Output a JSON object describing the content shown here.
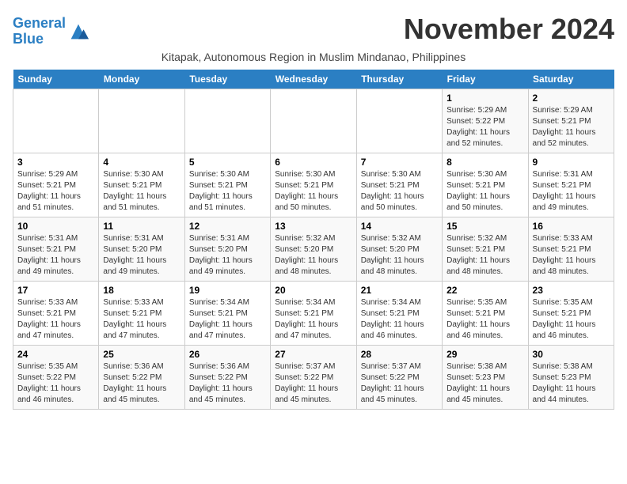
{
  "header": {
    "logo_line1": "General",
    "logo_line2": "Blue",
    "month_title": "November 2024",
    "subtitle": "Kitapak, Autonomous Region in Muslim Mindanao, Philippines"
  },
  "days_of_week": [
    "Sunday",
    "Monday",
    "Tuesday",
    "Wednesday",
    "Thursday",
    "Friday",
    "Saturday"
  ],
  "weeks": [
    {
      "days": [
        {
          "num": "",
          "info": ""
        },
        {
          "num": "",
          "info": ""
        },
        {
          "num": "",
          "info": ""
        },
        {
          "num": "",
          "info": ""
        },
        {
          "num": "",
          "info": ""
        },
        {
          "num": "1",
          "info": "Sunrise: 5:29 AM\nSunset: 5:22 PM\nDaylight: 11 hours\nand 52 minutes."
        },
        {
          "num": "2",
          "info": "Sunrise: 5:29 AM\nSunset: 5:21 PM\nDaylight: 11 hours\nand 52 minutes."
        }
      ]
    },
    {
      "days": [
        {
          "num": "3",
          "info": "Sunrise: 5:29 AM\nSunset: 5:21 PM\nDaylight: 11 hours\nand 51 minutes."
        },
        {
          "num": "4",
          "info": "Sunrise: 5:30 AM\nSunset: 5:21 PM\nDaylight: 11 hours\nand 51 minutes."
        },
        {
          "num": "5",
          "info": "Sunrise: 5:30 AM\nSunset: 5:21 PM\nDaylight: 11 hours\nand 51 minutes."
        },
        {
          "num": "6",
          "info": "Sunrise: 5:30 AM\nSunset: 5:21 PM\nDaylight: 11 hours\nand 50 minutes."
        },
        {
          "num": "7",
          "info": "Sunrise: 5:30 AM\nSunset: 5:21 PM\nDaylight: 11 hours\nand 50 minutes."
        },
        {
          "num": "8",
          "info": "Sunrise: 5:30 AM\nSunset: 5:21 PM\nDaylight: 11 hours\nand 50 minutes."
        },
        {
          "num": "9",
          "info": "Sunrise: 5:31 AM\nSunset: 5:21 PM\nDaylight: 11 hours\nand 49 minutes."
        }
      ]
    },
    {
      "days": [
        {
          "num": "10",
          "info": "Sunrise: 5:31 AM\nSunset: 5:21 PM\nDaylight: 11 hours\nand 49 minutes."
        },
        {
          "num": "11",
          "info": "Sunrise: 5:31 AM\nSunset: 5:20 PM\nDaylight: 11 hours\nand 49 minutes."
        },
        {
          "num": "12",
          "info": "Sunrise: 5:31 AM\nSunset: 5:20 PM\nDaylight: 11 hours\nand 49 minutes."
        },
        {
          "num": "13",
          "info": "Sunrise: 5:32 AM\nSunset: 5:20 PM\nDaylight: 11 hours\nand 48 minutes."
        },
        {
          "num": "14",
          "info": "Sunrise: 5:32 AM\nSunset: 5:20 PM\nDaylight: 11 hours\nand 48 minutes."
        },
        {
          "num": "15",
          "info": "Sunrise: 5:32 AM\nSunset: 5:21 PM\nDaylight: 11 hours\nand 48 minutes."
        },
        {
          "num": "16",
          "info": "Sunrise: 5:33 AM\nSunset: 5:21 PM\nDaylight: 11 hours\nand 48 minutes."
        }
      ]
    },
    {
      "days": [
        {
          "num": "17",
          "info": "Sunrise: 5:33 AM\nSunset: 5:21 PM\nDaylight: 11 hours\nand 47 minutes."
        },
        {
          "num": "18",
          "info": "Sunrise: 5:33 AM\nSunset: 5:21 PM\nDaylight: 11 hours\nand 47 minutes."
        },
        {
          "num": "19",
          "info": "Sunrise: 5:34 AM\nSunset: 5:21 PM\nDaylight: 11 hours\nand 47 minutes."
        },
        {
          "num": "20",
          "info": "Sunrise: 5:34 AM\nSunset: 5:21 PM\nDaylight: 11 hours\nand 47 minutes."
        },
        {
          "num": "21",
          "info": "Sunrise: 5:34 AM\nSunset: 5:21 PM\nDaylight: 11 hours\nand 46 minutes."
        },
        {
          "num": "22",
          "info": "Sunrise: 5:35 AM\nSunset: 5:21 PM\nDaylight: 11 hours\nand 46 minutes."
        },
        {
          "num": "23",
          "info": "Sunrise: 5:35 AM\nSunset: 5:21 PM\nDaylight: 11 hours\nand 46 minutes."
        }
      ]
    },
    {
      "days": [
        {
          "num": "24",
          "info": "Sunrise: 5:35 AM\nSunset: 5:22 PM\nDaylight: 11 hours\nand 46 minutes."
        },
        {
          "num": "25",
          "info": "Sunrise: 5:36 AM\nSunset: 5:22 PM\nDaylight: 11 hours\nand 45 minutes."
        },
        {
          "num": "26",
          "info": "Sunrise: 5:36 AM\nSunset: 5:22 PM\nDaylight: 11 hours\nand 45 minutes."
        },
        {
          "num": "27",
          "info": "Sunrise: 5:37 AM\nSunset: 5:22 PM\nDaylight: 11 hours\nand 45 minutes."
        },
        {
          "num": "28",
          "info": "Sunrise: 5:37 AM\nSunset: 5:22 PM\nDaylight: 11 hours\nand 45 minutes."
        },
        {
          "num": "29",
          "info": "Sunrise: 5:38 AM\nSunset: 5:23 PM\nDaylight: 11 hours\nand 45 minutes."
        },
        {
          "num": "30",
          "info": "Sunrise: 5:38 AM\nSunset: 5:23 PM\nDaylight: 11 hours\nand 44 minutes."
        }
      ]
    }
  ]
}
